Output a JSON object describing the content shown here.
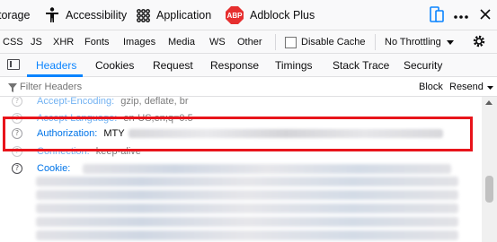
{
  "toolbar": {
    "tabs": [
      {
        "label": "torage",
        "icon": null
      },
      {
        "label": "Accessibility",
        "icon": "accessibility-icon"
      },
      {
        "label": "Application",
        "icon": "application-grid-icon"
      },
      {
        "label": "Adblock Plus",
        "icon": "adblock-plus-icon",
        "badge": "ABP"
      }
    ],
    "accent_color": "#0a84ff"
  },
  "type_filters": {
    "buttons": [
      "CSS",
      "JS",
      "XHR",
      "Fonts",
      "Images",
      "Media",
      "WS",
      "Other"
    ],
    "disable_cache_label": "Disable Cache",
    "throttling_label": "No Throttling"
  },
  "details": {
    "tabs": [
      "Headers",
      "Cookies",
      "Request",
      "Response",
      "Timings",
      "Stack Trace",
      "Security"
    ],
    "active_tab": "Headers"
  },
  "filter": {
    "placeholder": "Filter Headers",
    "block_label": "Block",
    "resend_label": "Resend"
  },
  "headers": [
    {
      "name": "Accept-Encoding:",
      "value": "gzip, deflate, br"
    },
    {
      "name": "Accept-Language:",
      "value": "en-US,en;q=0.5"
    },
    {
      "name": "Authorization:",
      "value": "MTY"
    },
    {
      "name": "Connection:",
      "value": "keep-alive"
    },
    {
      "name": "Cookie:",
      "value": ""
    }
  ],
  "highlight_color": "#e8141b"
}
